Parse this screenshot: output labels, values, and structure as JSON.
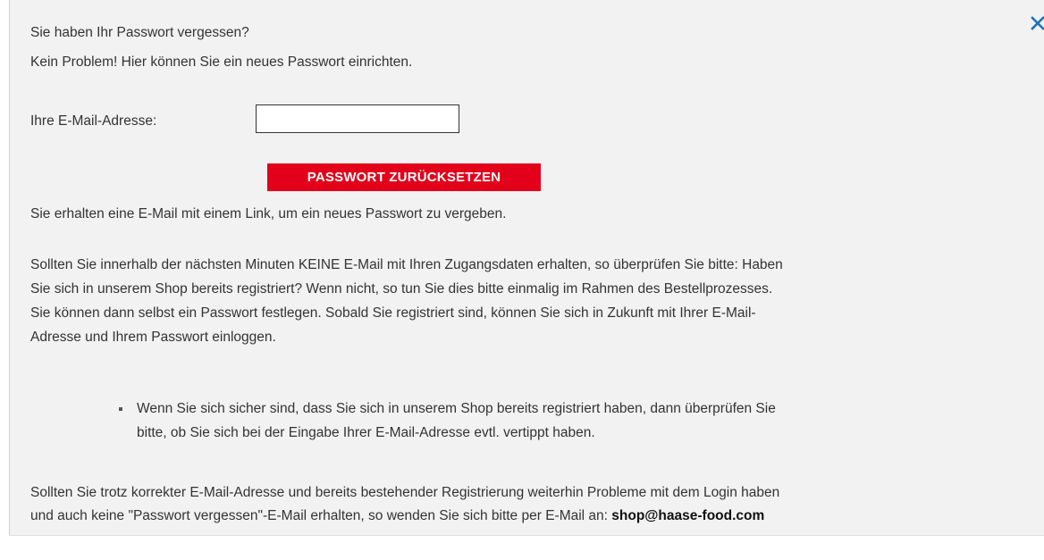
{
  "dialog": {
    "heading_line1": "Sie haben Ihr Passwort vergessen?",
    "heading_line2": "Kein Problem! Hier können Sie ein neues Passwort einrichten.",
    "close_icon": "close-icon",
    "accent_color": "#e2001a"
  },
  "form": {
    "email_label": "Ihre E-Mail-Adresse:",
    "email_value": "",
    "email_placeholder": "",
    "reset_button_label": "PASSWORT ZURÜCKSETZEN"
  },
  "info": {
    "confirmation": "Sie erhalten eine E-Mail mit einem Link, um ein neues Passwort zu vergeben.",
    "paragraph_lines": [
      "Sollten Sie innerhalb der nächsten Minuten KEINE E-Mail mit Ihren Zugangsdaten erhalten, so überprüfen Sie bitte: Haben",
      "Sie sich in unserem Shop bereits registriert? Wenn nicht, so tun Sie dies bitte einmalig im Rahmen des Bestellprozesses.",
      "Sie können dann selbst ein Passwort festlegen. Sobald Sie registriert sind, können Sie sich in Zukunft mit Ihrer E-Mail-",
      "Adresse und Ihrem Passwort einloggen."
    ],
    "bullet_lines": [
      "Wenn Sie sich sicher sind, dass Sie sich in unserem Shop bereits registriert haben, dann überprüfen Sie",
      "bitte, ob Sie sich bei der Eingabe Ihrer E-Mail-Adresse evtl. vertippt haben."
    ],
    "final_lines": [
      "Sollten Sie trotz korrekter E-Mail-Adresse und bereits bestehender Registrierung weiterhin Probleme mit dem Login haben",
      "und auch keine \"Passwort vergessen\"-E-Mail erhalten, so wenden Sie sich bitte per E-Mail an: "
    ],
    "support_email": "shop@haase-food.com"
  }
}
